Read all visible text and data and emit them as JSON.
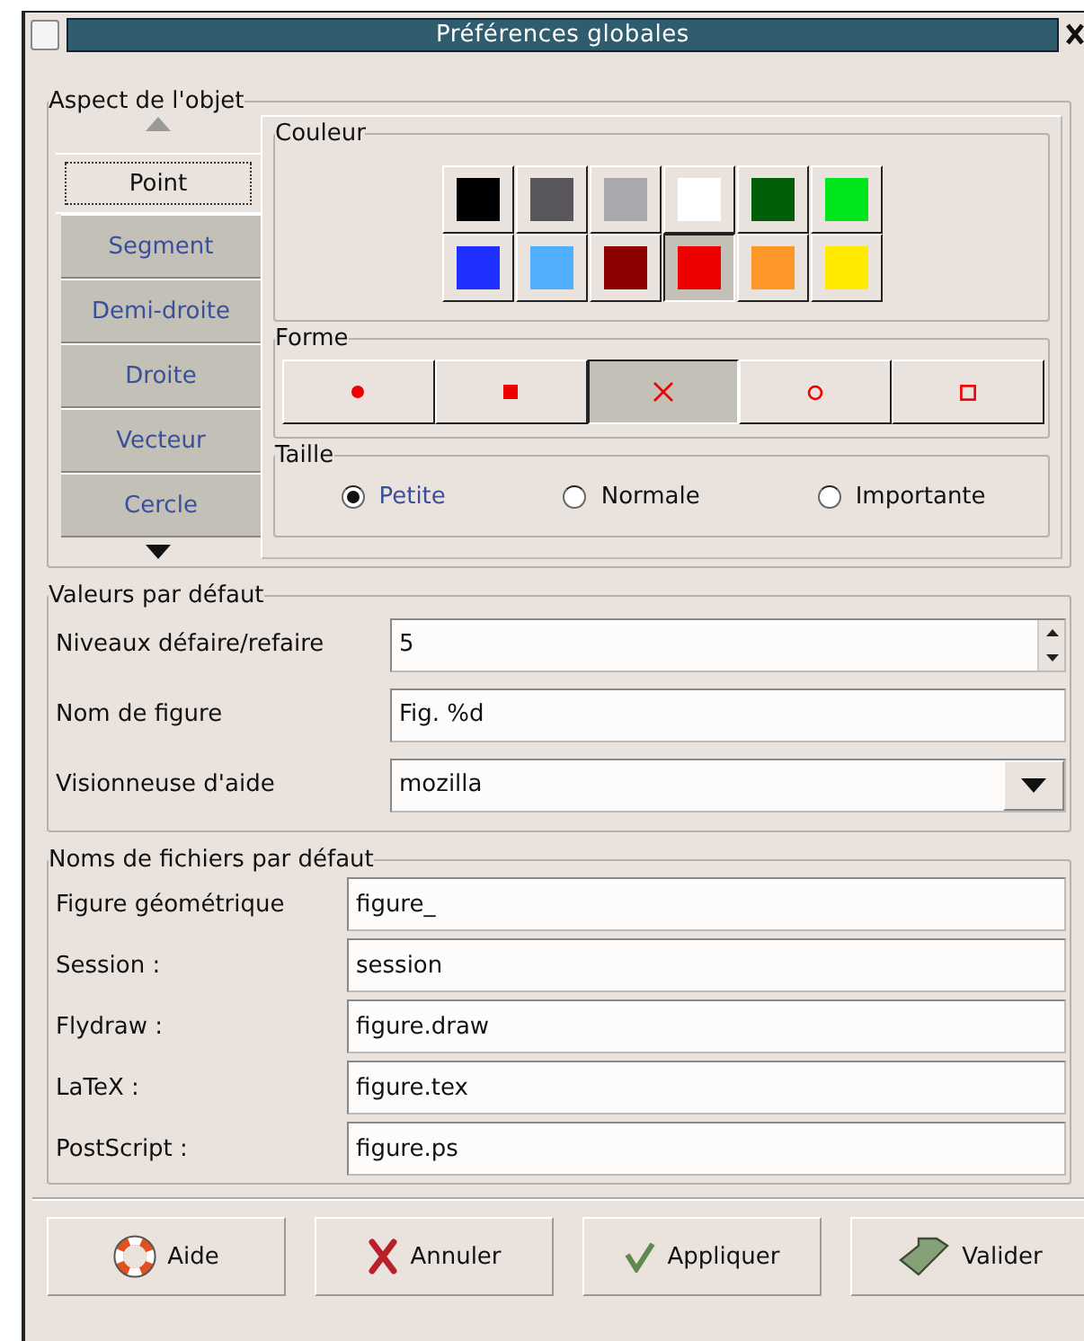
{
  "window": {
    "title": "Préférences globales"
  },
  "object_aspect": {
    "title": "Aspect de l'objet",
    "tabs": [
      {
        "label": "Point",
        "selected": true
      },
      {
        "label": "Segment",
        "selected": false
      },
      {
        "label": "Demi-droite",
        "selected": false
      },
      {
        "label": "Droite",
        "selected": false
      },
      {
        "label": "Vecteur",
        "selected": false
      },
      {
        "label": "Cercle",
        "selected": false
      }
    ],
    "color": {
      "title": "Couleur",
      "swatches": [
        {
          "color": "#000000",
          "selected": false
        },
        {
          "color": "#59575c",
          "selected": false
        },
        {
          "color": "#a9a8ad",
          "selected": false
        },
        {
          "color": "#ffffff",
          "selected": false
        },
        {
          "color": "#00600a",
          "selected": false
        },
        {
          "color": "#00e61e",
          "selected": false
        },
        {
          "color": "#1d30ff",
          "selected": false
        },
        {
          "color": "#50b0ff",
          "selected": false
        },
        {
          "color": "#8c0000",
          "selected": false
        },
        {
          "color": "#ef0000",
          "selected": true
        },
        {
          "color": "#ff9628",
          "selected": false
        },
        {
          "color": "#ffea00",
          "selected": false
        }
      ]
    },
    "shape": {
      "title": "Forme",
      "options": [
        {
          "kind": "dot",
          "selected": false
        },
        {
          "kind": "square",
          "selected": false
        },
        {
          "kind": "cross",
          "selected": true
        },
        {
          "kind": "circle",
          "selected": false
        },
        {
          "kind": "box",
          "selected": false
        }
      ]
    },
    "size": {
      "title": "Taille",
      "options": [
        {
          "label": "Petite",
          "selected": true
        },
        {
          "label": "Normale",
          "selected": false
        },
        {
          "label": "Importante",
          "selected": false
        }
      ]
    }
  },
  "defaults": {
    "title": "Valeurs par défaut",
    "fields": [
      {
        "kind": "spin",
        "label": "Niveaux défaire/refaire",
        "value": "5"
      },
      {
        "kind": "text",
        "label": "Nom de figure",
        "value": "Fig. %d"
      },
      {
        "kind": "select",
        "label": "Visionneuse d'aide",
        "value": "mozilla"
      }
    ]
  },
  "file_names": {
    "title": "Noms de fichiers par défaut",
    "fields": [
      {
        "label": "Figure géométrique",
        "value": "figure_"
      },
      {
        "label": "Session :",
        "value": "session"
      },
      {
        "label": "Flydraw :",
        "value": "figure.draw"
      },
      {
        "label": "LaTeX :",
        "value": "figure.tex"
      },
      {
        "label": "PostScript :",
        "value": "figure.ps"
      }
    ]
  },
  "buttons": [
    {
      "kind": "help",
      "label": "Aide"
    },
    {
      "kind": "cancel",
      "label": "Annuler"
    },
    {
      "kind": "apply",
      "label": "Appliquer"
    },
    {
      "kind": "ok",
      "label": "Valider"
    }
  ]
}
